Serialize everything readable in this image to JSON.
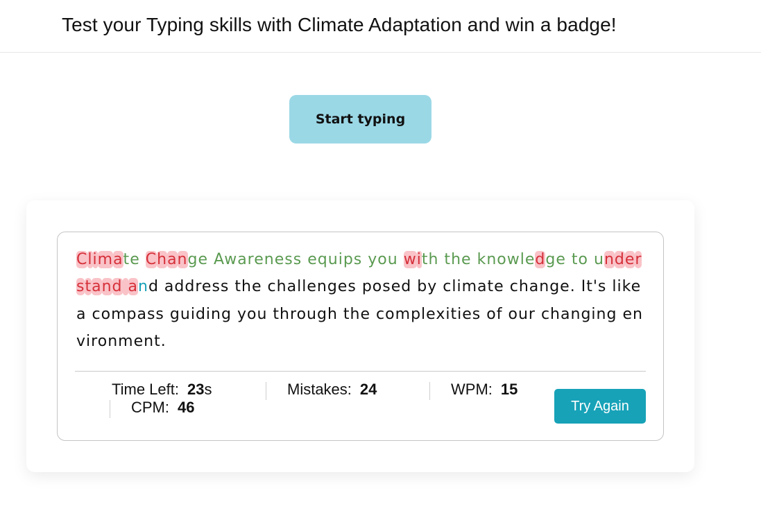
{
  "header": {
    "title": "Test your Typing skills with Climate Adaptation and win a badge!"
  },
  "start_button": {
    "label": "Start typing"
  },
  "typing": {
    "segments": [
      {
        "t": "Clima",
        "s": "wrong"
      },
      {
        "t": "te",
        "s": "correct"
      },
      {
        "t": " ",
        "s": "pending"
      },
      {
        "t": "Chan",
        "s": "wrong"
      },
      {
        "t": "ge Awareness equips you ",
        "s": "correct"
      },
      {
        "t": "wi",
        "s": "wrong"
      },
      {
        "t": "th the knowle",
        "s": "correct"
      },
      {
        "t": "d",
        "s": "wrong"
      },
      {
        "t": "ge to u",
        "s": "correct"
      },
      {
        "t": "nderstand a",
        "s": "wrong"
      },
      {
        "t": "n",
        "s": "active"
      },
      {
        "t": "d address the challenges posed by climate change. It's like a compass guiding you through the complexities of our changing environment.",
        "s": "pending"
      }
    ]
  },
  "stats": {
    "time_left": {
      "label": "Time Left:",
      "value": "23",
      "unit": "s"
    },
    "mistakes": {
      "label": "Mistakes:",
      "value": "24"
    },
    "wpm": {
      "label": "WPM:",
      "value": "15"
    },
    "cpm": {
      "label": "CPM:",
      "value": "46"
    }
  },
  "try_again_button": {
    "label": "Try Again"
  },
  "colors": {
    "correct": "#5a9a50",
    "wrong_text": "#d6303a",
    "wrong_bg": "#f9c3c8",
    "active": "#1aa2b8",
    "start_button_bg": "#9bd8e6",
    "try_again_bg": "#17a2b8"
  }
}
